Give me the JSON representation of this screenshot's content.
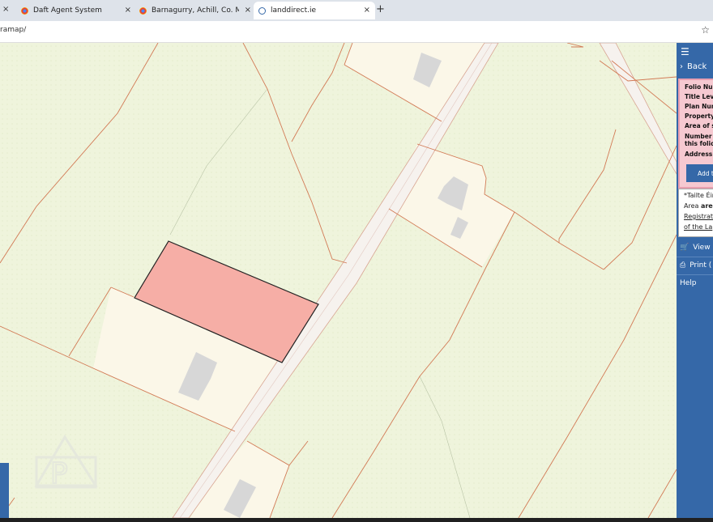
{
  "tabs": [
    {
      "title": "Daft Agent System",
      "active": false
    },
    {
      "title": "Barnagurry, Achill, Co. Mayo is f",
      "active": false
    },
    {
      "title": "landdirect.ie",
      "active": true
    }
  ],
  "new_tab_glyph": "+",
  "close_glyph": "×",
  "address": "ramap/",
  "panel": {
    "back_label": "Back",
    "info_rows": [
      "Folio Num",
      "Title Leve",
      "Plan Num",
      "Property N",
      "Area of se",
      "Number o",
      "this folio:",
      "Address"
    ],
    "add_button": "Add to",
    "note_line1": "*Tailte Éir",
    "note_line2_pre": "Area ",
    "note_line2_bold": "are n",
    "note_link1": "Registrat",
    "note_link2": "of the La",
    "view_label": "View B",
    "print_label": "Print (",
    "help_label": "Help"
  },
  "colors": {
    "map_bg": "#eff4dc",
    "parcel_line": "#d27a55",
    "road_fill": "#f6f2ee",
    "plot_fill": "#fbf7e8",
    "highlight_fill": "#f6aea6",
    "building_fill": "#d7d7d7",
    "panel_blue": "#3568a8",
    "info_pink": "#f6c9d1"
  }
}
